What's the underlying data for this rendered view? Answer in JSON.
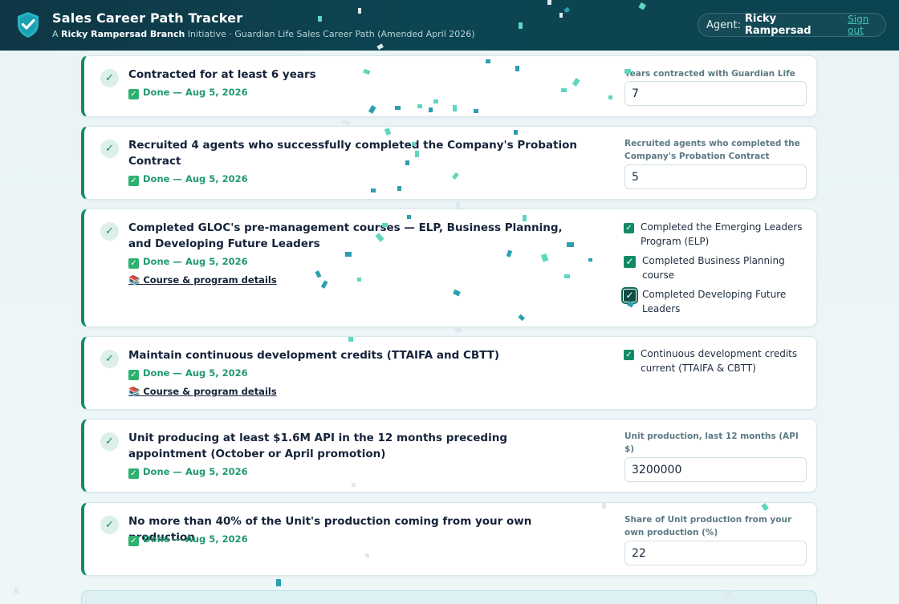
{
  "header": {
    "title": "Sales Career Path Tracker",
    "subtitle_prefix": "A",
    "branch": "Ricky Rampersad Branch",
    "subtitle_rest": "Initiative · Guardian Life Sales Career Path (Amended April 2026)",
    "agent_label": "Agent:",
    "agent_name": "Ricky Rampersad",
    "signout": "Sign out"
  },
  "colors": {
    "header_bg": "#0d4451",
    "accent_green": "#138a66",
    "done_green": "#1f9a6c",
    "link_teal": "#44c7b5"
  },
  "requirements": [
    {
      "title": "Contracted for at least 6 years",
      "status": "Done — Aug 5, 2026",
      "field_label": "Years contracted with Guardian Life",
      "value": "7"
    },
    {
      "title": "Recruited 4 agents who successfully completed the Company's Probation Contract",
      "status": "Done — Aug 5, 2026",
      "field_label": "Recruited agents who completed the Company's Probation Contract",
      "value": "5"
    },
    {
      "title": "Completed GLOC's pre-management courses — ELP, Business Planning, and Developing Future Leaders",
      "status": "Done — Aug 5, 2026",
      "link": "📚 Course & program details",
      "checkboxes": [
        {
          "label": "Completed the Emerging Leaders Program (ELP)",
          "checked": true
        },
        {
          "label": "Completed Business Planning course",
          "checked": true
        },
        {
          "label": "Completed Developing Future Leaders",
          "checked": true
        }
      ]
    },
    {
      "title": "Maintain continuous development credits (TTAIFA and CBTT)",
      "status": "Done — Aug 5, 2026",
      "link": "📚 Course & program details",
      "checkboxes": [
        {
          "label": "Continuous development credits current (TTAIFA & CBTT)",
          "checked": true
        }
      ]
    },
    {
      "title": "Unit producing at least $1.6M API in the 12 months preceding appointment (October or April promotion)",
      "status": "Done — Aug 5, 2026",
      "field_label": "Unit production, last 12 months (API $)",
      "value": "3200000"
    },
    {
      "title": "No more than 40% of the Unit's production coming from your own production",
      "status": "Done — Aug 5, 2026",
      "field_label": "Share of Unit production from your own production (%)",
      "value": "22"
    }
  ]
}
